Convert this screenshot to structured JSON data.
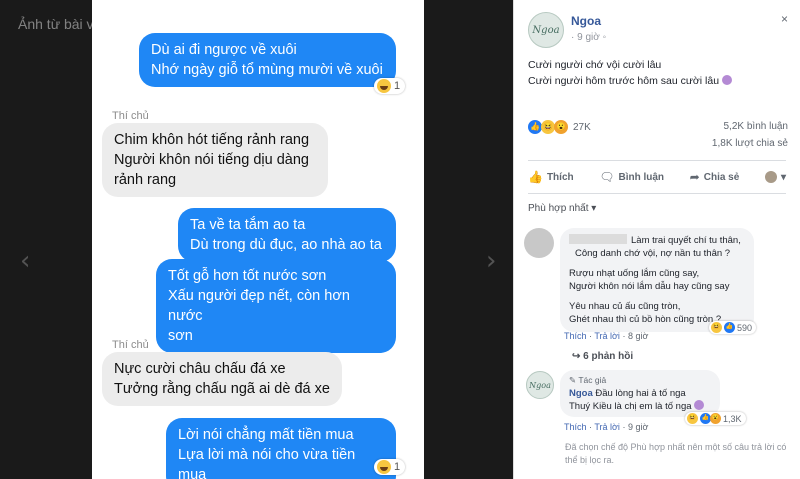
{
  "viewer": {
    "title": "Ảnh từ bài viết của Ngoa",
    "messages": [
      {
        "side": "right",
        "lines": [
          "Dù ai đi ngược về xuôi",
          "Nhớ ngày giỗ tổ mùng mười về xuôi"
        ],
        "reaction_count": "1"
      },
      {
        "side": "left",
        "sender": "Thí chủ",
        "lines": [
          "Chim khôn hót tiếng rảnh rang",
          "Người khôn nói tiếng dịu dàng",
          "rảnh rang"
        ]
      },
      {
        "side": "right",
        "lines": [
          "Ta về ta tắm ao ta",
          "Dù trong dù đục, ao nhà ao ta"
        ]
      },
      {
        "side": "right",
        "lines": [
          "Tốt gỗ hơn tốt nước sơn",
          "Xấu người đẹp nết, còn hơn nước",
          "sơn"
        ]
      },
      {
        "side": "left",
        "sender": "Thí chủ",
        "lines": [
          "Nực cười châu chấu đá xe",
          "Tưởng rằng chấu ngã ai dè đá xe"
        ]
      },
      {
        "side": "right",
        "lines": [
          "Lời nói chẳng mất tiền mua",
          "Lựa lời mà nói cho vừa tiền mua"
        ],
        "reaction_count": "1"
      }
    ]
  },
  "post": {
    "author": "Ngoa",
    "avatar_text": "Ngoa",
    "time": "9 giờ",
    "close_icon": "×",
    "text_lines": [
      "Cười người chớ vội cười lâu",
      "Cười người hôm trước hôm sau cười lâu"
    ],
    "reactions_total": "27K",
    "comments": "5,2K bình luận",
    "shares": "1,8K lượt chia sẻ",
    "actions": {
      "like": "Thích",
      "comment": "Bình luận",
      "share": "Chia sẻ"
    },
    "filter_label": "Phù hợp nhất"
  },
  "comments": [
    {
      "lines": [
        "Làm trai quyết chí tu thân,",
        "Công danh chớ vội, nợ nần tu thân ?",
        "",
        "Rượu nhạt uống lắm cũng say,",
        "Người khôn nói lắm dẫu hay cũng say",
        "",
        "Yêu nhau củ ấu cũng tròn,",
        "Ghét nhau thì củ bồ hòn cũng tròn ?"
      ],
      "actions": {
        "like": "Thích",
        "reply": "Trả lời",
        "time": "8 giờ"
      },
      "reactions": "590",
      "replies": "6 phản hồi"
    },
    {
      "badge": "Tác giả",
      "name": "Ngoa",
      "lines": [
        "Đầu lòng hai ả tố nga",
        "Thuý Kiều là chị em là tố nga"
      ],
      "actions": {
        "like": "Thích",
        "reply": "Trả lời",
        "time": "9 giờ"
      },
      "reactions": "1,3K"
    }
  ],
  "footnote": "Đã chọn chế độ Phù hợp nhất nên một số câu trả lời có thể bị lọc ra.",
  "colors": {
    "messenger_blue": "#1f87f5",
    "fb_link": "#365899",
    "fb_like": "#2078f4"
  }
}
